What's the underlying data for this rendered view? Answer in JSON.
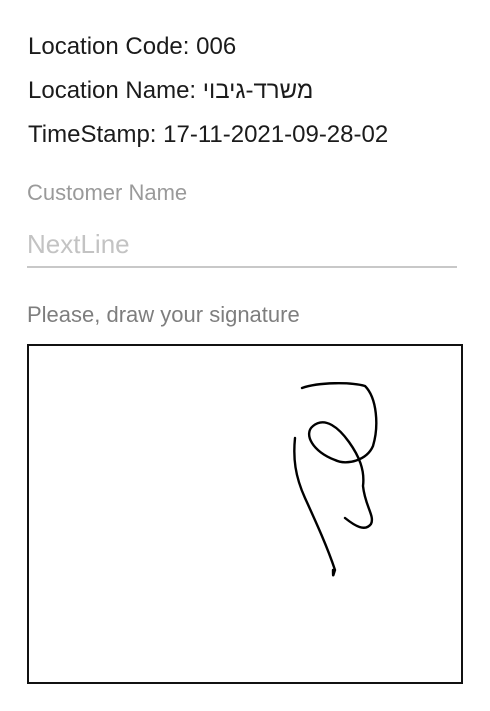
{
  "info": {
    "location_code_label": "Location Code: ",
    "location_code_value": "006",
    "location_name_label": "Location Name: ",
    "location_name_value": "משרד-גיבוי",
    "timestamp_label": "TimeStamp: ",
    "timestamp_value": "17-11-2021-09-28-02"
  },
  "customer": {
    "label": "Customer Name",
    "placeholder": "NextLine",
    "value": ""
  },
  "signature": {
    "prompt": "Please, draw your signature",
    "stroke_color": "#000000"
  }
}
